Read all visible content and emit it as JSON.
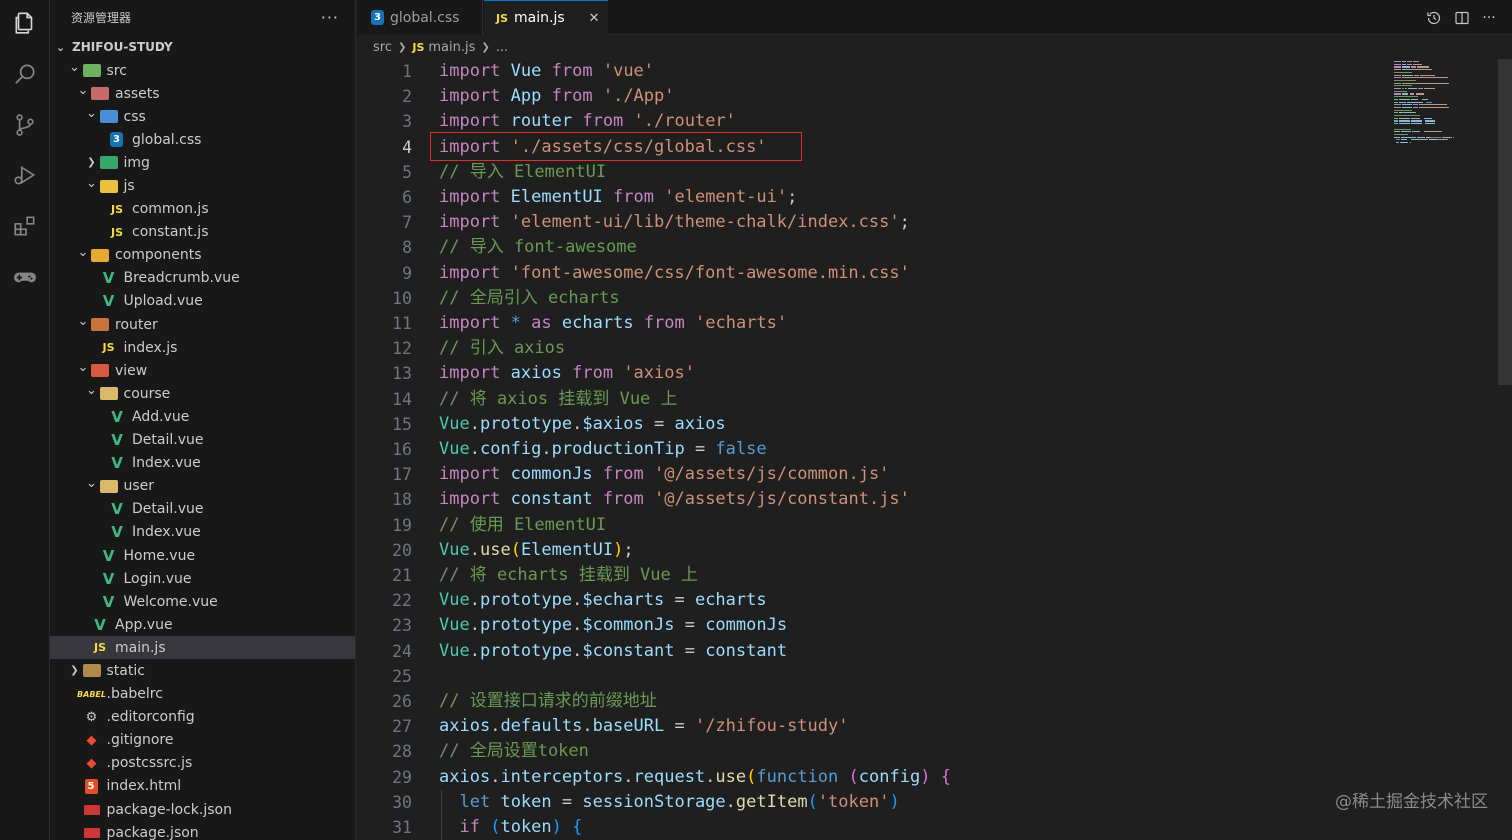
{
  "sidebar": {
    "title": "资源管理器",
    "more": "···",
    "workspace": "ZHIFOU-STUDY",
    "tree": [
      {
        "label": "src",
        "depth": 1,
        "chev": "down",
        "icon": "folder",
        "color": "#6eb05d"
      },
      {
        "label": "assets",
        "depth": 2,
        "chev": "down",
        "icon": "folder",
        "color": "#c96a6a"
      },
      {
        "label": "css",
        "depth": 3,
        "chev": "down",
        "icon": "folder",
        "color": "#4a8fd6"
      },
      {
        "label": "global.css",
        "depth": 4,
        "chev": "none",
        "icon": "css"
      },
      {
        "label": "img",
        "depth": 3,
        "chev": "right",
        "icon": "folder",
        "color": "#3aa56b"
      },
      {
        "label": "js",
        "depth": 3,
        "chev": "down",
        "icon": "folder",
        "color": "#e8c23d"
      },
      {
        "label": "common.js",
        "depth": 4,
        "chev": "none",
        "icon": "js"
      },
      {
        "label": "constant.js",
        "depth": 4,
        "chev": "none",
        "icon": "js"
      },
      {
        "label": "components",
        "depth": 2,
        "chev": "down",
        "icon": "folder",
        "color": "#e6a935"
      },
      {
        "label": "Breadcrumb.vue",
        "depth": 3,
        "chev": "none",
        "icon": "vue"
      },
      {
        "label": "Upload.vue",
        "depth": 3,
        "chev": "none",
        "icon": "vue"
      },
      {
        "label": "router",
        "depth": 2,
        "chev": "down",
        "icon": "folder",
        "color": "#c9733d"
      },
      {
        "label": "index.js",
        "depth": 3,
        "chev": "none",
        "icon": "js"
      },
      {
        "label": "view",
        "depth": 2,
        "chev": "down",
        "icon": "folder",
        "color": "#d65a3f"
      },
      {
        "label": "course",
        "depth": 3,
        "chev": "down",
        "icon": "folder",
        "color": "#d9b86a"
      },
      {
        "label": "Add.vue",
        "depth": 4,
        "chev": "none",
        "icon": "vue"
      },
      {
        "label": "Detail.vue",
        "depth": 4,
        "chev": "none",
        "icon": "vue"
      },
      {
        "label": "Index.vue",
        "depth": 4,
        "chev": "none",
        "icon": "vue"
      },
      {
        "label": "user",
        "depth": 3,
        "chev": "down",
        "icon": "folder",
        "color": "#d9b86a"
      },
      {
        "label": "Detail.vue",
        "depth": 4,
        "chev": "none",
        "icon": "vue"
      },
      {
        "label": "Index.vue",
        "depth": 4,
        "chev": "none",
        "icon": "vue"
      },
      {
        "label": "Home.vue",
        "depth": 3,
        "chev": "none",
        "icon": "vue"
      },
      {
        "label": "Login.vue",
        "depth": 3,
        "chev": "none",
        "icon": "vue"
      },
      {
        "label": "Welcome.vue",
        "depth": 3,
        "chev": "none",
        "icon": "vue"
      },
      {
        "label": "App.vue",
        "depth": 2,
        "chev": "none",
        "icon": "vue"
      },
      {
        "label": "main.js",
        "depth": 2,
        "chev": "none",
        "icon": "js",
        "selected": true
      },
      {
        "label": "static",
        "depth": 1,
        "chev": "right",
        "icon": "folder",
        "color": "#b08a4a"
      },
      {
        "label": ".babelrc",
        "depth": 1,
        "chev": "none",
        "icon": "babel"
      },
      {
        "label": ".editorconfig",
        "depth": 1,
        "chev": "none",
        "icon": "generic"
      },
      {
        "label": ".gitignore",
        "depth": 1,
        "chev": "none",
        "icon": "git"
      },
      {
        "label": ".postcssrc.js",
        "depth": 1,
        "chev": "none",
        "icon": "git"
      },
      {
        "label": "index.html",
        "depth": 1,
        "chev": "none",
        "icon": "html"
      },
      {
        "label": "package-lock.json",
        "depth": 1,
        "chev": "none",
        "icon": "json"
      },
      {
        "label": "package.json",
        "depth": 1,
        "chev": "none",
        "icon": "json"
      }
    ]
  },
  "tabs": {
    "inactive": {
      "label": "global.css",
      "icon": "3"
    },
    "active": {
      "label": "main.js",
      "icon": "JS",
      "close": "✕"
    }
  },
  "breadcrumb": {
    "part1": "src",
    "icon": "JS",
    "part2": "main.js",
    "ellipsis": "..."
  },
  "icon_labels": {
    "js": "JS",
    "css": "3",
    "html": "5",
    "vue": "V",
    "babel": "BABEL",
    "generic": "⚙",
    "git": "◆"
  },
  "editor": {
    "current_line": 4,
    "lines": [
      [
        [
          "k",
          "import"
        ],
        [
          "p",
          " "
        ],
        [
          "v",
          "Vue"
        ],
        [
          "p",
          " "
        ],
        [
          "k",
          "from"
        ],
        [
          "p",
          " "
        ],
        [
          "s",
          "'vue'"
        ]
      ],
      [
        [
          "k",
          "import"
        ],
        [
          "p",
          " "
        ],
        [
          "v",
          "App"
        ],
        [
          "p",
          " "
        ],
        [
          "k",
          "from"
        ],
        [
          "p",
          " "
        ],
        [
          "s",
          "'./App'"
        ]
      ],
      [
        [
          "k",
          "import"
        ],
        [
          "p",
          " "
        ],
        [
          "v",
          "router"
        ],
        [
          "p",
          " "
        ],
        [
          "k",
          "from"
        ],
        [
          "p",
          " "
        ],
        [
          "s",
          "'./router'"
        ]
      ],
      [
        [
          "k",
          "import"
        ],
        [
          "p",
          " "
        ],
        [
          "s",
          "'./assets/css/global.css'"
        ]
      ],
      [
        [
          "c",
          "// 导入 ElementUI"
        ]
      ],
      [
        [
          "k",
          "import"
        ],
        [
          "p",
          " "
        ],
        [
          "v",
          "ElementUI"
        ],
        [
          "p",
          " "
        ],
        [
          "k",
          "from"
        ],
        [
          "p",
          " "
        ],
        [
          "s",
          "'element-ui'"
        ],
        [
          "p",
          ";"
        ]
      ],
      [
        [
          "k",
          "import"
        ],
        [
          "p",
          " "
        ],
        [
          "s",
          "'element-ui/lib/theme-chalk/index.css'"
        ],
        [
          "p",
          ";"
        ]
      ],
      [
        [
          "c",
          "// 导入 font-awesome"
        ]
      ],
      [
        [
          "k",
          "import"
        ],
        [
          "p",
          " "
        ],
        [
          "s",
          "'font-awesome/css/font-awesome.min.css'"
        ]
      ],
      [
        [
          "c",
          "// 全局引入 echarts"
        ]
      ],
      [
        [
          "k",
          "import"
        ],
        [
          "p",
          " "
        ],
        [
          "b",
          "*"
        ],
        [
          "p",
          " "
        ],
        [
          "k",
          "as"
        ],
        [
          "p",
          " "
        ],
        [
          "v",
          "echarts"
        ],
        [
          "p",
          " "
        ],
        [
          "k",
          "from"
        ],
        [
          "p",
          " "
        ],
        [
          "s",
          "'echarts'"
        ]
      ],
      [
        [
          "c",
          "// 引入 axios"
        ]
      ],
      [
        [
          "k",
          "import"
        ],
        [
          "p",
          " "
        ],
        [
          "v",
          "axios"
        ],
        [
          "p",
          " "
        ],
        [
          "k",
          "from"
        ],
        [
          "p",
          " "
        ],
        [
          "s",
          "'axios'"
        ]
      ],
      [
        [
          "c",
          "// 将 axios 挂载到 Vue 上"
        ]
      ],
      [
        [
          "t",
          "Vue"
        ],
        [
          "p",
          "."
        ],
        [
          "v",
          "prototype"
        ],
        [
          "p",
          "."
        ],
        [
          "v",
          "$axios"
        ],
        [
          "p",
          " = "
        ],
        [
          "v",
          "axios"
        ]
      ],
      [
        [
          "t",
          "Vue"
        ],
        [
          "p",
          "."
        ],
        [
          "v",
          "config"
        ],
        [
          "p",
          "."
        ],
        [
          "v",
          "productionTip"
        ],
        [
          "p",
          " = "
        ],
        [
          "b",
          "false"
        ]
      ],
      [
        [
          "k",
          "import"
        ],
        [
          "p",
          " "
        ],
        [
          "v",
          "commonJs"
        ],
        [
          "p",
          " "
        ],
        [
          "k",
          "from"
        ],
        [
          "p",
          " "
        ],
        [
          "s",
          "'@/assets/js/common.js'"
        ]
      ],
      [
        [
          "k",
          "import"
        ],
        [
          "p",
          " "
        ],
        [
          "v",
          "constant"
        ],
        [
          "p",
          " "
        ],
        [
          "k",
          "from"
        ],
        [
          "p",
          " "
        ],
        [
          "s",
          "'@/assets/js/constant.js'"
        ]
      ],
      [
        [
          "c",
          "// 使用 ElementUI"
        ]
      ],
      [
        [
          "t",
          "Vue"
        ],
        [
          "p",
          "."
        ],
        [
          "f",
          "use"
        ],
        [
          "y",
          "("
        ],
        [
          "v",
          "ElementUI"
        ],
        [
          "y",
          ")"
        ],
        [
          "p",
          ";"
        ]
      ],
      [
        [
          "c",
          "// 将 echarts 挂载到 Vue 上"
        ]
      ],
      [
        [
          "t",
          "Vue"
        ],
        [
          "p",
          "."
        ],
        [
          "v",
          "prototype"
        ],
        [
          "p",
          "."
        ],
        [
          "v",
          "$echarts"
        ],
        [
          "p",
          " = "
        ],
        [
          "v",
          "echarts"
        ]
      ],
      [
        [
          "t",
          "Vue"
        ],
        [
          "p",
          "."
        ],
        [
          "v",
          "prototype"
        ],
        [
          "p",
          "."
        ],
        [
          "v",
          "$commonJs"
        ],
        [
          "p",
          " = "
        ],
        [
          "v",
          "commonJs"
        ]
      ],
      [
        [
          "t",
          "Vue"
        ],
        [
          "p",
          "."
        ],
        [
          "v",
          "prototype"
        ],
        [
          "p",
          "."
        ],
        [
          "v",
          "$constant"
        ],
        [
          "p",
          " = "
        ],
        [
          "v",
          "constant"
        ]
      ],
      [],
      [
        [
          "c",
          "// 设置接口请求的前缀地址"
        ]
      ],
      [
        [
          "v",
          "axios"
        ],
        [
          "p",
          "."
        ],
        [
          "v",
          "defaults"
        ],
        [
          "p",
          "."
        ],
        [
          "v",
          "baseURL"
        ],
        [
          "p",
          " = "
        ],
        [
          "s",
          "'/zhifou-study'"
        ]
      ],
      [
        [
          "c",
          "// 全局设置token"
        ]
      ],
      [
        [
          "v",
          "axios"
        ],
        [
          "p",
          "."
        ],
        [
          "v",
          "interceptors"
        ],
        [
          "p",
          "."
        ],
        [
          "v",
          "request"
        ],
        [
          "p",
          "."
        ],
        [
          "f",
          "use"
        ],
        [
          "y",
          "("
        ],
        [
          "b",
          "function"
        ],
        [
          "p",
          " "
        ],
        [
          "pk",
          "("
        ],
        [
          "v",
          "config"
        ],
        [
          "pk",
          ")"
        ],
        [
          "p",
          " "
        ],
        [
          "pk",
          "{"
        ]
      ],
      [
        [
          "p",
          "  "
        ],
        [
          "b",
          "let"
        ],
        [
          "p",
          " "
        ],
        [
          "v",
          "token"
        ],
        [
          "p",
          " = "
        ],
        [
          "v",
          "sessionStorage"
        ],
        [
          "p",
          "."
        ],
        [
          "f",
          "getItem"
        ],
        [
          "bl",
          "("
        ],
        [
          "s",
          "'token'"
        ],
        [
          "bl",
          ")"
        ]
      ],
      [
        [
          "p",
          "  "
        ],
        [
          "k",
          "if"
        ],
        [
          "p",
          " "
        ],
        [
          "bl",
          "("
        ],
        [
          "v",
          "token"
        ],
        [
          "bl",
          ")"
        ],
        [
          "p",
          " "
        ],
        [
          "bl",
          "{"
        ]
      ]
    ]
  },
  "watermark": "@稀土掘金技术社区"
}
